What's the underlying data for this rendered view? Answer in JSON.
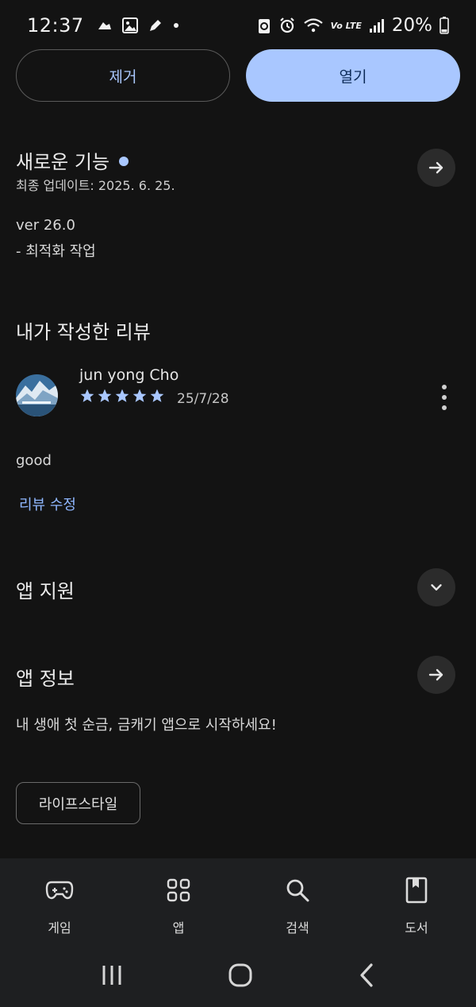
{
  "status": {
    "time": "12:37",
    "battery": "20%",
    "network": "Vo LTE"
  },
  "actions": {
    "remove_label": "제거",
    "open_label": "열기"
  },
  "whats_new": {
    "title": "새로운 기능",
    "updated": "최종 업데이트: 2025. 6. 25.",
    "version": "ver 26.0",
    "notes": "- 최적화 작업"
  },
  "my_review": {
    "title": "내가 작성한 리뷰",
    "reviewer": "jun yong Cho",
    "rating": 5,
    "date": "25/7/28",
    "text": "good",
    "edit_label": "리뷰 수정"
  },
  "app_support": {
    "title": "앱 지원"
  },
  "app_info": {
    "title": "앱 정보",
    "description": "내 생애 첫 순금, 금캐기 앱으로 시작하세요!",
    "category_tag": "라이프스타일"
  },
  "bottom_nav": {
    "items": [
      {
        "label": "게임",
        "icon": "gamepad-icon"
      },
      {
        "label": "앱",
        "icon": "apps-grid-icon"
      },
      {
        "label": "검색",
        "icon": "search-icon"
      },
      {
        "label": "도서",
        "icon": "book-icon"
      }
    ]
  },
  "colors": {
    "background": "#131313",
    "accent": "#a9c7ff",
    "link": "#8fb7ff",
    "star": "#a9c7ff"
  }
}
